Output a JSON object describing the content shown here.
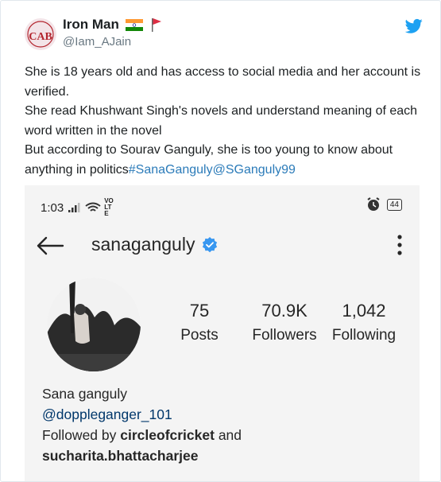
{
  "tweet": {
    "author_name": "Iron Man",
    "author_handle": "@Iam_AJain",
    "avatar_text": "CAB",
    "icons": [
      "india-flag-icon",
      "red-flag-icon",
      "twitter-bird-icon"
    ],
    "text_lines": [
      "She is 18 years old and has access to social media and her account is verified.",
      "She read Khushwant Singh's novels and understand meaning of each word written in the novel",
      "But according to Sourav Ganguly, she is too young to know about anything in politics"
    ],
    "hashtag": "#SanaGanguly",
    "mention": "@SGanguly99",
    "colors": {
      "link": "#2b7bb9",
      "text": "#1c2022",
      "handle": "#697882",
      "twitter": "#1da1f2"
    }
  },
  "instagram": {
    "status_bar": {
      "time": "1:03",
      "network": "VO LTE",
      "battery": "44"
    },
    "username": "sanaganguly",
    "verified": true,
    "stats": [
      {
        "value": "75",
        "label": "Posts"
      },
      {
        "value": "70.9K",
        "label": "Followers"
      },
      {
        "value": "1,042",
        "label": "Following"
      }
    ],
    "bio": {
      "name": "Sana ganguly",
      "link": "@doppleganger_101",
      "followed_by_prefix": "Followed by",
      "followed_by_1": "circleofcricket",
      "and": "and",
      "followed_by_2": "sucharita.bhattacharjee"
    },
    "colors": {
      "verified": "#3897f0",
      "link": "#00376b"
    }
  }
}
